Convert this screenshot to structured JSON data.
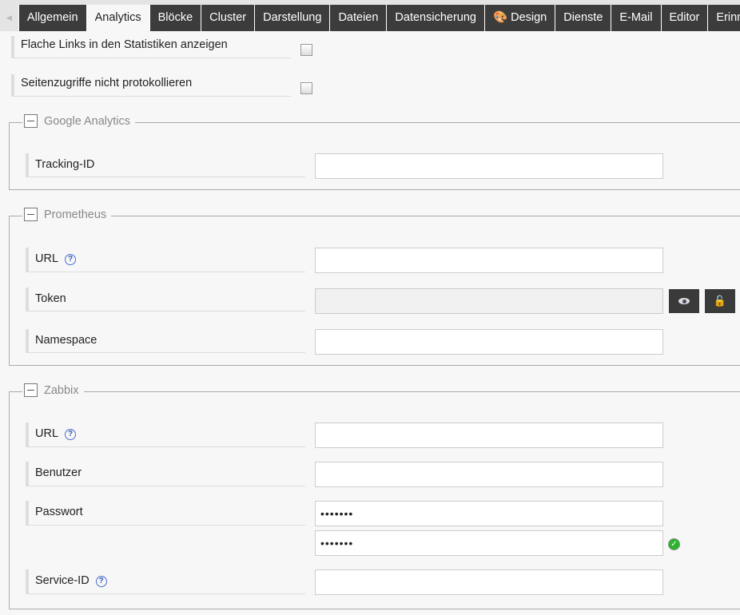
{
  "tabs": [
    {
      "label": "Allgemein"
    },
    {
      "label": "Analytics",
      "active": true
    },
    {
      "label": "Blöcke"
    },
    {
      "label": "Cluster"
    },
    {
      "label": "Darstellung"
    },
    {
      "label": "Dateien"
    },
    {
      "label": "Datensicherung"
    },
    {
      "label": "Design",
      "icon": "palette-icon"
    },
    {
      "label": "Dienste"
    },
    {
      "label": "E-Mail"
    },
    {
      "label": "Editor"
    },
    {
      "label": "Erinn"
    }
  ],
  "general": {
    "flat_links": "Flache Links in den Statistiken anzeigen",
    "no_logging": "Seitenzugriffe nicht protokollieren"
  },
  "google": {
    "legend": "Google Analytics",
    "tracking_id": "Tracking-ID",
    "tracking_value": ""
  },
  "prometheus": {
    "legend": "Prometheus",
    "url": "URL",
    "token": "Token",
    "namespace": "Namespace"
  },
  "zabbix": {
    "legend": "Zabbix",
    "url": "URL",
    "user": "Benutzer",
    "password": "Passwort",
    "password_value": "•••••••",
    "password_confirm": "•••••••",
    "service_id": "Service-ID"
  },
  "help_glyph": "?"
}
